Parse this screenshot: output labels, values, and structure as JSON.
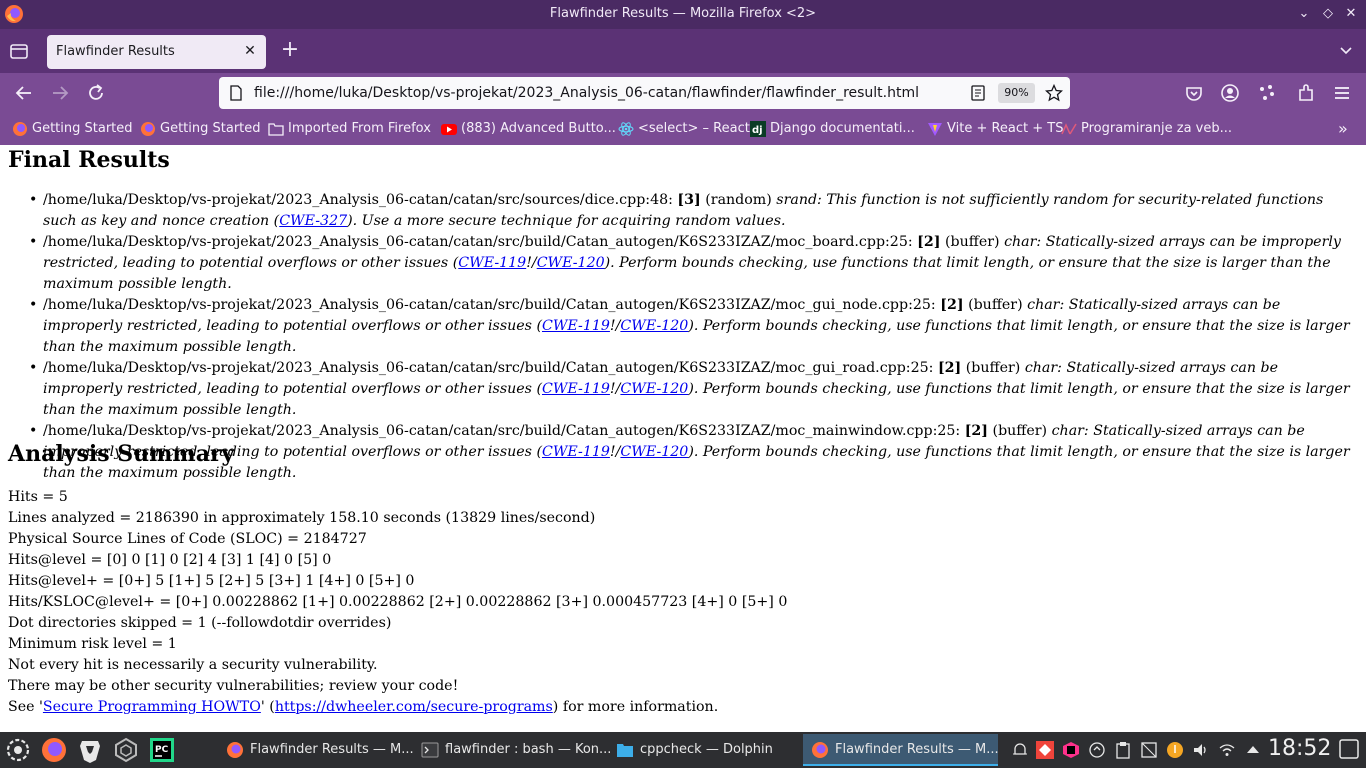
{
  "window": {
    "title": "Flawfinder Results — Mozilla Firefox <2>"
  },
  "tab": {
    "label": "Flawfinder Results"
  },
  "urlbar": {
    "url": "file:///home/luka/Desktop/vs-projekat/2023_Analysis_06-catan/flawfinder/flawfinder_result.html",
    "zoom": "90%"
  },
  "bookmarks": [
    {
      "label": "Getting Started",
      "icon": "firefox-icon"
    },
    {
      "label": "Getting Started",
      "icon": "firefox-icon"
    },
    {
      "label": "Imported From Firefox",
      "icon": "folder-icon"
    },
    {
      "label": "(883) Advanced Butto...",
      "icon": "youtube-icon"
    },
    {
      "label": "<select> – React",
      "icon": "react-icon"
    },
    {
      "label": "Django documentati...",
      "icon": "django-icon"
    },
    {
      "label": "Vite + React + TS",
      "icon": "vite-icon"
    },
    {
      "label": "Programiranje za veb...",
      "icon": "web-icon"
    }
  ],
  "content": {
    "final_title": "Final Results",
    "results": [
      {
        "path": "/home/luka/Desktop/vs-projekat/2023_Analysis_06-catan/catan/src/sources/dice.cpp:48:",
        "level": "[3]",
        "category": "(random)",
        "msg_a": "srand: This function is not sufficiently random for security-related functions such as key and nonce creation (",
        "cwe1": "CWE-327",
        "msg_b": "). Use a more secure technique for acquiring random values."
      },
      {
        "path": "/home/luka/Desktop/vs-projekat/2023_Analysis_06-catan/catan/src/build/Catan_autogen/K6S233IZAZ/moc_board.cpp:25:",
        "level": "[2]",
        "category": "(buffer)",
        "msg_a": "char: Statically-sized arrays can be improperly restricted, leading to potential overflows or other issues (",
        "cwe1": "CWE-119",
        "sep": "!/",
        "cwe2": "CWE-120",
        "msg_b": "). Perform bounds checking, use functions that limit length, or ensure that the size is larger than the maximum possible length."
      },
      {
        "path": "/home/luka/Desktop/vs-projekat/2023_Analysis_06-catan/catan/src/build/Catan_autogen/K6S233IZAZ/moc_gui_node.cpp:25:",
        "level": "[2]",
        "category": "(buffer)",
        "msg_a": "char: Statically-sized arrays can be improperly restricted, leading to potential overflows or other issues (",
        "cwe1": "CWE-119",
        "sep": "!/",
        "cwe2": "CWE-120",
        "msg_b": "). Perform bounds checking, use functions that limit length, or ensure that the size is larger than the maximum possible length."
      },
      {
        "path": "/home/luka/Desktop/vs-projekat/2023_Analysis_06-catan/catan/src/build/Catan_autogen/K6S233IZAZ/moc_gui_road.cpp:25:",
        "level": "[2]",
        "category": "(buffer)",
        "msg_a": "char: Statically-sized arrays can be improperly restricted, leading to potential overflows or other issues (",
        "cwe1": "CWE-119",
        "sep": "!/",
        "cwe2": "CWE-120",
        "msg_b": "). Perform bounds checking, use functions that limit length, or ensure that the size is larger than the maximum possible length."
      },
      {
        "path": "/home/luka/Desktop/vs-projekat/2023_Analysis_06-catan/catan/src/build/Catan_autogen/K6S233IZAZ/moc_mainwindow.cpp:25:",
        "level": "[2]",
        "category": "(buffer)",
        "msg_a": "char: Statically-sized arrays can be improperly restricted, leading to potential overflows or other issues (",
        "cwe1": "CWE-119",
        "sep": "!/",
        "cwe2": "CWE-120",
        "msg_b": "). Perform bounds checking, use functions that limit length, or ensure that the size is larger than the maximum possible length."
      }
    ],
    "summary_title": "Analysis Summary",
    "summary_lines": [
      "Hits = 5",
      "Lines analyzed = 2186390 in approximately 158.10 seconds (13829 lines/second)",
      "Physical Source Lines of Code (SLOC) = 2184727",
      "Hits@level = [0] 0 [1] 0 [2] 4 [3] 1 [4] 0 [5] 0",
      "Hits@level+ = [0+] 5 [1+] 5 [2+] 5 [3+] 1 [4+] 0 [5+] 0",
      "Hits/KSLOC@level+ = [0+] 0.00228862 [1+] 0.00228862 [2+] 0.00228862 [3+] 0.000457723 [4+] 0 [5+] 0",
      "Dot directories skipped = 1 (--followdotdir overrides)",
      "Minimum risk level = 1",
      "Not every hit is necessarily a security vulnerability.",
      "There may be other security vulnerabilities; review your code!"
    ],
    "see": {
      "prefix": "See '",
      "link1": "Secure Programming HOWTO",
      "mid": "' (",
      "link2": "https://dwheeler.com/secure-programs",
      "suffix": ") for more information."
    }
  },
  "taskbar": {
    "tasks": [
      {
        "label": "Flawfinder Results — M...",
        "icon": "firefox-icon",
        "active": false
      },
      {
        "label": "flawfinder : bash — Kon...",
        "icon": "terminal-icon",
        "active": false
      },
      {
        "label": "cppcheck — Dolphin",
        "icon": "folder-icon",
        "active": false
      },
      {
        "label": "Flawfinder Results — M...",
        "icon": "firefox-icon",
        "active": true
      }
    ],
    "clock": "18:52"
  },
  "colors": {
    "titlebar": "#4a2a63",
    "tabbar": "#5b3275",
    "toolbar": "#7a4b94",
    "link": "#0000ee",
    "taskbar": "#2d2e31",
    "active_task": "#3d5a73"
  }
}
